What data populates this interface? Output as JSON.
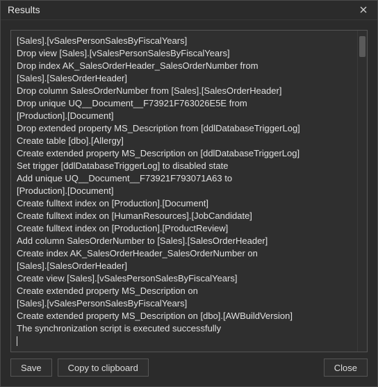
{
  "window": {
    "title": "Results"
  },
  "log": {
    "lines": [
      "[Sales].[vSalesPersonSalesByFiscalYears]",
      "Drop view [Sales].[vSalesPersonSalesByFiscalYears]",
      "Drop index AK_SalesOrderHeader_SalesOrderNumber from",
      "[Sales].[SalesOrderHeader]",
      "Drop column SalesOrderNumber from [Sales].[SalesOrderHeader]",
      "Drop unique UQ__Document__F73921F763026E5E from",
      "[Production].[Document]",
      "Drop extended property MS_Description from [ddlDatabaseTriggerLog]",
      "Create table [dbo].[Allergy]",
      "Create extended property MS_Description on [ddlDatabaseTriggerLog]",
      "Set trigger [ddlDatabaseTriggerLog] to disabled state",
      "Add unique UQ__Document__F73921F793071A63 to",
      "[Production].[Document]",
      "Create fulltext index on [Production].[Document]",
      "Create fulltext index on [HumanResources].[JobCandidate]",
      "Create fulltext index on [Production].[ProductReview]",
      "Add column SalesOrderNumber to [Sales].[SalesOrderHeader]",
      "Create index AK_SalesOrderHeader_SalesOrderNumber on",
      "[Sales].[SalesOrderHeader]",
      "Create view [Sales].[vSalesPersonSalesByFiscalYears]",
      "Create extended property MS_Description on",
      "[Sales].[vSalesPersonSalesByFiscalYears]",
      "Create extended property MS_Description on [dbo].[AWBuildVersion]",
      "The synchronization script is executed successfully"
    ]
  },
  "buttons": {
    "save": "Save",
    "copy": "Copy to clipboard",
    "close": "Close"
  }
}
